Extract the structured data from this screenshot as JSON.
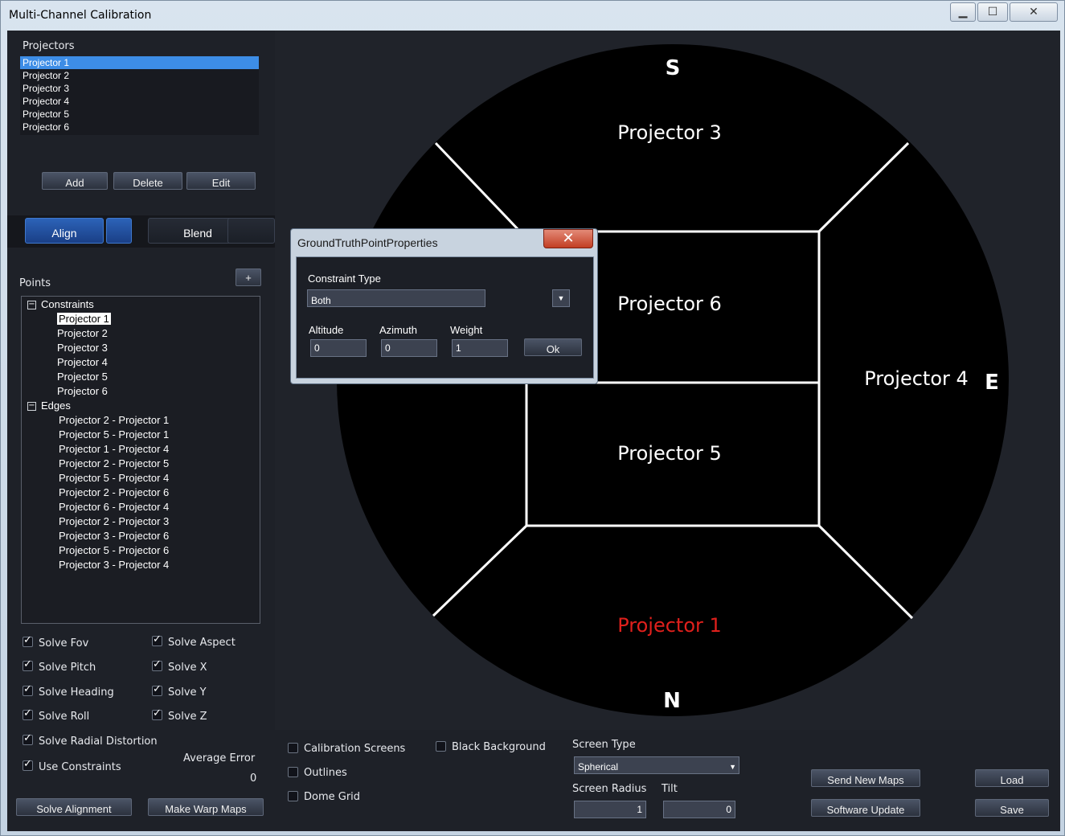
{
  "window": {
    "title": "Multi-Channel Calibration"
  },
  "projectors": {
    "label": "Projectors",
    "items": [
      "Projector 1",
      "Projector 2",
      "Projector 3",
      "Projector 4",
      "Projector 5",
      "Projector 6"
    ],
    "selected": 0,
    "add": "Add",
    "delete": "Delete",
    "edit": "Edit"
  },
  "tabs": {
    "align": "Align",
    "blend": "Blend"
  },
  "points": {
    "label": "Points",
    "add_symbol": "+",
    "constraints_label": "Constraints",
    "constraints": [
      "Projector 1",
      "Projector 2",
      "Projector 3",
      "Projector 4",
      "Projector 5",
      "Projector 6"
    ],
    "edges_label": "Edges",
    "edges": [
      "Projector 2 - Projector 1",
      "Projector 5 - Projector 1",
      "Projector 1 - Projector 4",
      "Projector 2 - Projector 5",
      "Projector 5 - Projector 4",
      "Projector 2 - Projector 6",
      "Projector 6 - Projector 4",
      "Projector 2 - Projector 3",
      "Projector 3 - Projector 6",
      "Projector 5 - Projector 6",
      "Projector 3 - Projector 4"
    ]
  },
  "solve": {
    "fov": "Solve Fov",
    "aspect": "Solve Aspect",
    "pitch": "Solve Pitch",
    "x": "Solve X",
    "heading": "Solve Heading",
    "y": "Solve Y",
    "roll": "Solve Roll",
    "z": "Solve Z",
    "radial": "Solve Radial Distortion",
    "constraints": "Use Constraints",
    "avg_error_label": "Average Error",
    "avg_error_value": "0",
    "solve_alignment": "Solve Alignment",
    "make_warp_maps": "Make Warp Maps"
  },
  "dome": {
    "north": "N",
    "south": "S",
    "east": "E",
    "p1": "Projector 1",
    "p3": "Projector 3",
    "p4": "Projector 4",
    "p5": "Projector 5",
    "p6": "Projector 6",
    "highlight_color": "#e0201c"
  },
  "options": {
    "calibration_screens": "Calibration Screens",
    "outlines": "Outlines",
    "dome_grid": "Dome Grid",
    "black_background": "Black Background"
  },
  "screen": {
    "type_label": "Screen Type",
    "type_value": "Spherical",
    "radius_label": "Screen Radius",
    "radius_value": "1",
    "tilt_label": "Tilt",
    "tilt_value": "0"
  },
  "actions": {
    "send_new_maps": "Send New Maps",
    "software_update": "Software Update",
    "load": "Load",
    "save": "Save"
  },
  "dialog": {
    "title": "GroundTruthPointProperties",
    "close": "✕",
    "constraint_type_label": "Constraint Type",
    "constraint_type_value": "Both",
    "altitude_label": "Altitude",
    "altitude_value": "0",
    "azimuth_label": "Azimuth",
    "azimuth_value": "0",
    "weight_label": "Weight",
    "weight_value": "1",
    "ok": "Ok"
  }
}
